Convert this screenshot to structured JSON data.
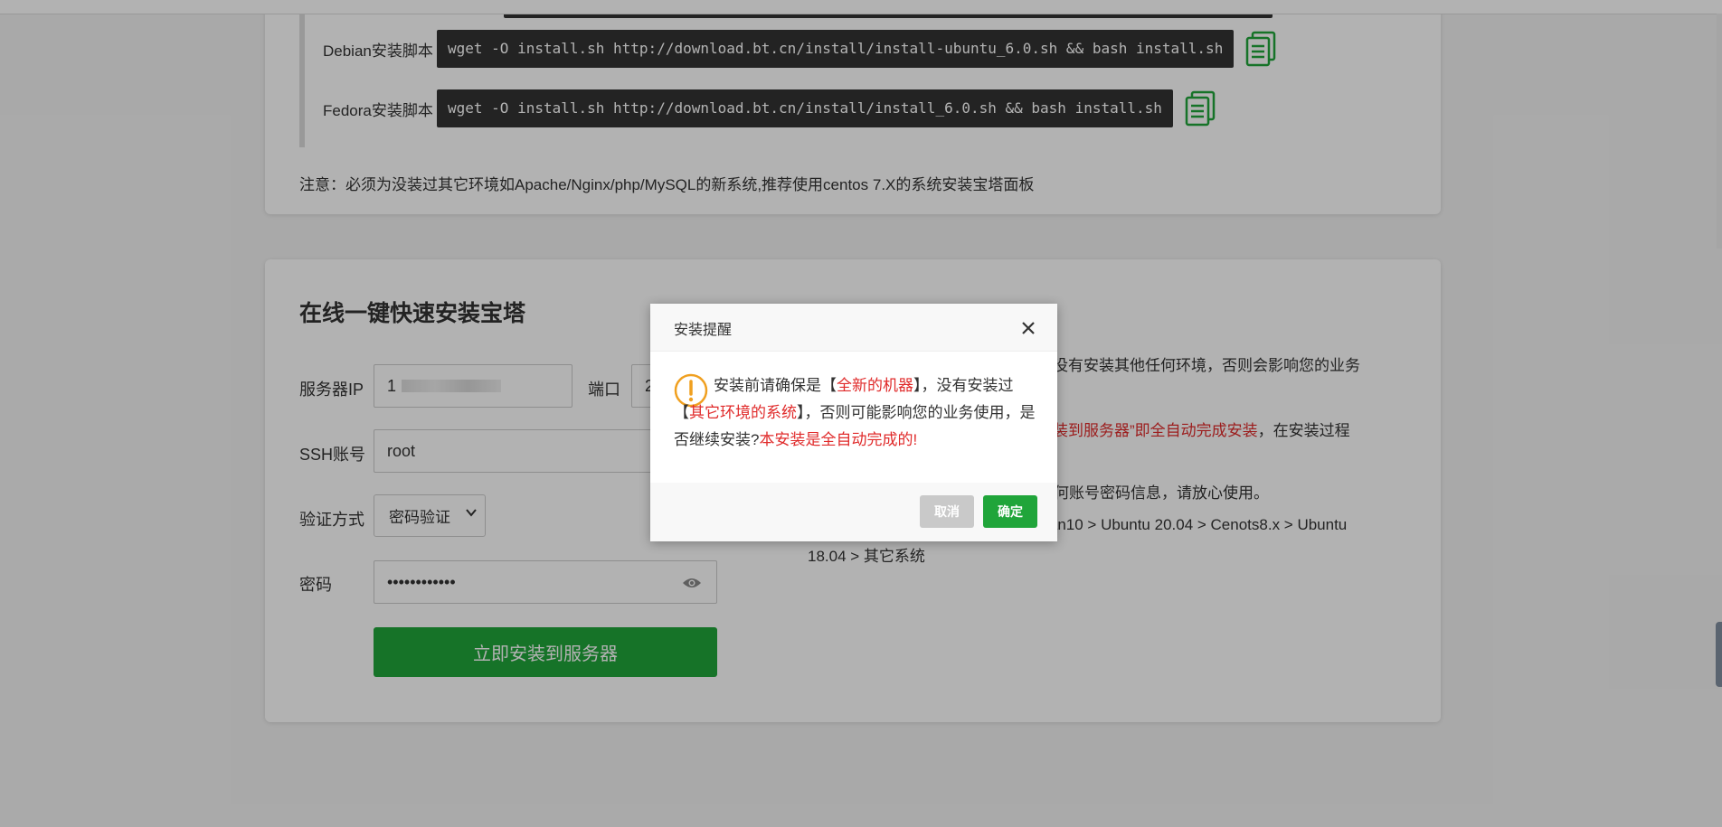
{
  "scripts": {
    "rows": [
      {
        "label": "Debian安装脚本",
        "command": "wget -O install.sh http://download.bt.cn/install/install-ubuntu_6.0.sh && bash install.sh"
      },
      {
        "label": "Fedora安装脚本",
        "command": "wget -O install.sh http://download.bt.cn/install/install_6.0.sh && bash install.sh"
      }
    ],
    "note": "注意：必须为没装过其它环境如Apache/Nginx/php/MySQL的新系统,推荐使用centos 7.X的系统安装宝塔面板"
  },
  "install": {
    "title": "在线一键快速安装宝塔",
    "server_ip_label": "服务器IP",
    "server_ip_value": "1",
    "port_label": "端口",
    "port_value": "2",
    "ssh_label": "SSH账号",
    "ssh_value": "root",
    "auth_label": "验证方式",
    "auth_value": "密码验证",
    "password_label": "密码",
    "password_value": "••••••••••••",
    "install_button": "立即安装到服务器",
    "tips": {
      "tip1_tail": "没有安装其他任何环境，否则会影响您的业务",
      "tip2_red": "装到服务器”即全自动完成安装",
      "tip2_tail": "，在安装过程",
      "tip3": "数据传输过程中加密处理，不保存任何账号密码信息，请放心使用。",
      "tip4_line1": "系统兼容性推荐：Centos7.x > Debian10 > Ubuntu 20.04 > Cenots8.x > Ubuntu",
      "tip4_line2": "18.04 > 其它系统"
    }
  },
  "dialog": {
    "title": "安装提醒",
    "msg_part1": "安装前请确保是【",
    "msg_red1": "全新的机器",
    "msg_part2": "】，没有安装过【",
    "msg_red2": "其它环境的系统",
    "msg_part3": "】，否则可能影响您的业务使用，是否继续安装?",
    "msg_red3": "本安装是全自动完成的!",
    "cancel": "取消",
    "confirm": "确定"
  },
  "colors": {
    "accent": "#20a53a",
    "warning_red": "#e02b2b",
    "warning_icon": "#f0a020"
  }
}
